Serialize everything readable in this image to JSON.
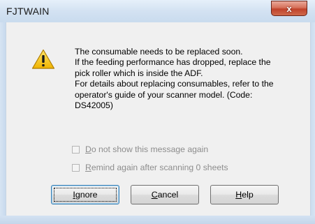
{
  "window": {
    "title": "FJTWAIN",
    "close_glyph": "x"
  },
  "icon": {
    "name": "warning-icon",
    "color": "#f5c400"
  },
  "message": {
    "lines": [
      "The consumable needs to be replaced soon.",
      "If the feeding performance has dropped, replace the",
      "pick roller which is inside the ADF.",
      "For details about replacing consumables, refer to the",
      "operator's guide of your scanner model.  (Code:",
      "DS42005)"
    ]
  },
  "options": {
    "do_not_show": {
      "mnemonic": "D",
      "rest": "o not show this message again",
      "checked": false,
      "enabled": false
    },
    "remind": {
      "mnemonic": "R",
      "rest": "emind again after scanning 0 sheets",
      "checked": false,
      "enabled": false
    }
  },
  "buttons": {
    "ignore": {
      "mnemonic": "I",
      "rest": "gnore"
    },
    "cancel": {
      "mnemonic": "C",
      "rest": "ancel"
    },
    "help": {
      "mnemonic": "H",
      "rest": "elp"
    }
  }
}
